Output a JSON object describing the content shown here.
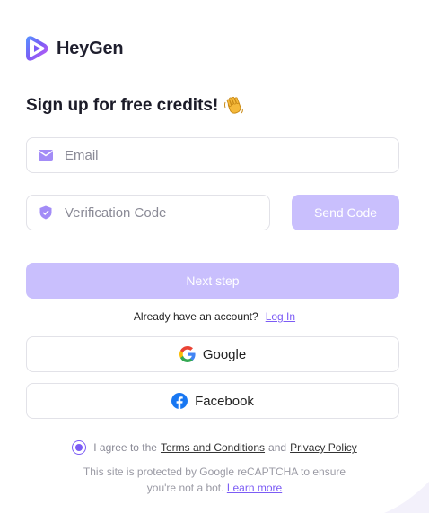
{
  "brand": {
    "name": "HeyGen",
    "logo_icon": "heygen-logo-icon"
  },
  "heading": {
    "text": "Sign up for free credits!",
    "emoji_icon": "waving-hand-icon"
  },
  "email": {
    "placeholder": "Email",
    "value": "",
    "icon": "envelope-icon"
  },
  "code": {
    "placeholder": "Verification Code",
    "value": "",
    "icon": "shield-icon"
  },
  "buttons": {
    "send_code": "Send Code",
    "next_step": "Next step"
  },
  "login": {
    "prompt": "Already have an account?",
    "link": "Log In"
  },
  "social": {
    "google": "Google",
    "facebook": "Facebook"
  },
  "agreement": {
    "prefix": "I agree to the",
    "terms": "Terms and Conditions",
    "and": "and",
    "privacy": "Privacy Policy"
  },
  "recaptcha": {
    "line1": "This site is protected by Google reCAPTCHA to ensure",
    "line2": "you're not a bot.",
    "learn_more": "Learn more"
  },
  "colors": {
    "accent": "#7c5cf5",
    "button_disabled": "#c9bffd",
    "border": "#e2e2e8"
  }
}
